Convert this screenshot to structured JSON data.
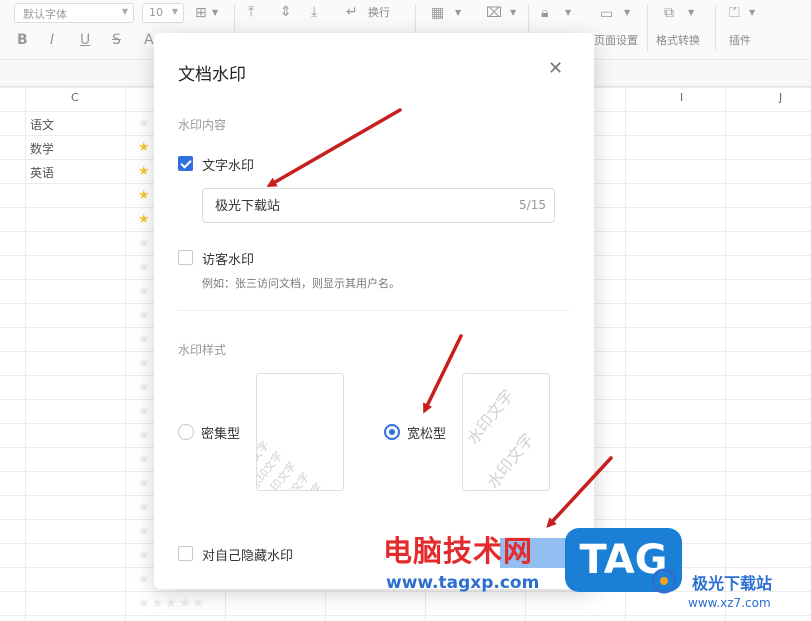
{
  "toolbar": {
    "font_family": "默认字体",
    "font_size": "10",
    "wrap_label": "换行",
    "page_setup_label": "页面设置",
    "format_convert_label": "格式转换",
    "plugin_label": "插件"
  },
  "sheet": {
    "columns": [
      "C",
      "I",
      "J"
    ],
    "cells": [
      "语文",
      "数学",
      "英语"
    ]
  },
  "dialog": {
    "title": "文档水印",
    "content_section": "水印内容",
    "text_watermark": {
      "label": "文字水印",
      "checked": true,
      "value": "极光下载站",
      "count": "5/15"
    },
    "visitor_watermark": {
      "label": "访客水印",
      "checked": false,
      "hint": "例如：张三访问文档，则显示其用户名。"
    },
    "style_section": "水印样式",
    "styles": [
      {
        "label": "密集型",
        "selected": false,
        "preview_text": "水印文字"
      },
      {
        "label": "宽松型",
        "selected": true,
        "preview_text": "水印文字"
      }
    ],
    "hide_self": {
      "label": "对自己隐藏水印",
      "checked": false
    }
  },
  "overlay": {
    "brand_cn": "电脑技术网",
    "brand_url": "www.tagxp.com",
    "tag_text": "TAG",
    "site_cn": "极光下载站",
    "site_url": "www.xz7.com"
  },
  "colors": {
    "accent": "#2f6fde",
    "arrow": "#c81e1e",
    "tag_bg": "#1b7fd6"
  }
}
